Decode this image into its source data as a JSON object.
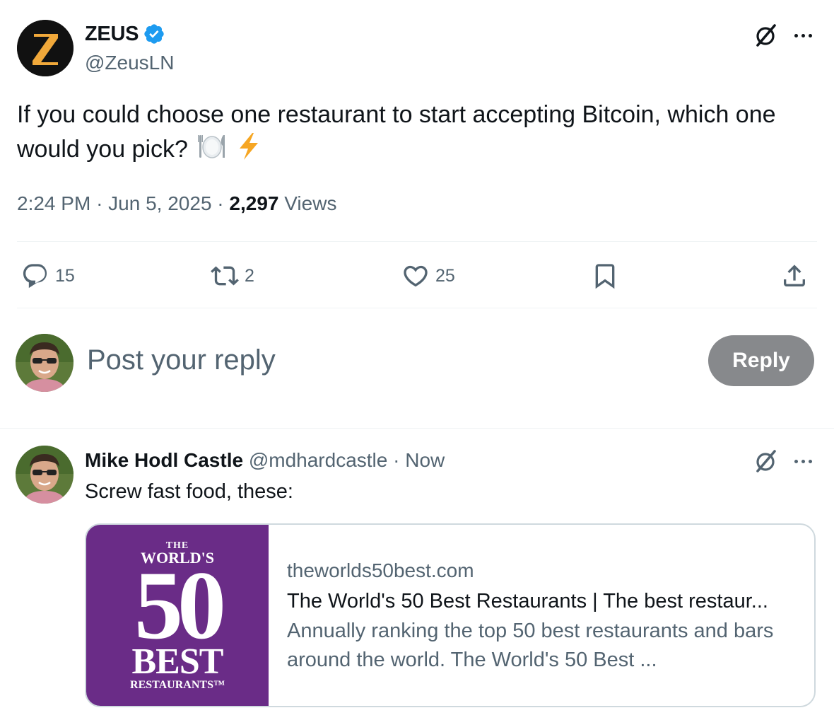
{
  "main_tweet": {
    "author_name": "ZEUS",
    "author_handle": "@ZeusLN",
    "avatar_letter": "Z",
    "text": "If you could choose one restaurant to start accepting Bitcoin, which one would you pick?",
    "emoji_icons": [
      "fork-knife-plate-icon",
      "lightning-icon"
    ],
    "time": "2:24 PM",
    "date": "Jun 5, 2025",
    "views_count": "2,297",
    "views_label": "Views",
    "separator": "·"
  },
  "actions": {
    "replies": "15",
    "reposts": "2",
    "likes": "25"
  },
  "composer": {
    "placeholder": "Post your reply",
    "button_label": "Reply"
  },
  "reply_tweet": {
    "author_name": "Mike Hodl Castle",
    "author_handle": "@mdhardcastle",
    "timestamp": "Now",
    "text": "Screw fast food, these:",
    "card": {
      "domain": "theworlds50best.com",
      "title": "The World's 50 Best Restaurants | The best restaur...",
      "description": "Annually ranking the top 50 best restaurants and bars around the world. The World's 50 Best ...",
      "logo": {
        "the": "THE",
        "worlds": "WORLD'S",
        "number": "50",
        "best": "BEST",
        "restaurants": "RESTAURANTS™"
      }
    }
  },
  "colors": {
    "verified_blue": "#1d9bf0",
    "muted_text": "#536471",
    "card_logo_bg": "#6a2c87",
    "zeus_gold": "#f0a83a",
    "reply_button_bg": "#87898c"
  }
}
